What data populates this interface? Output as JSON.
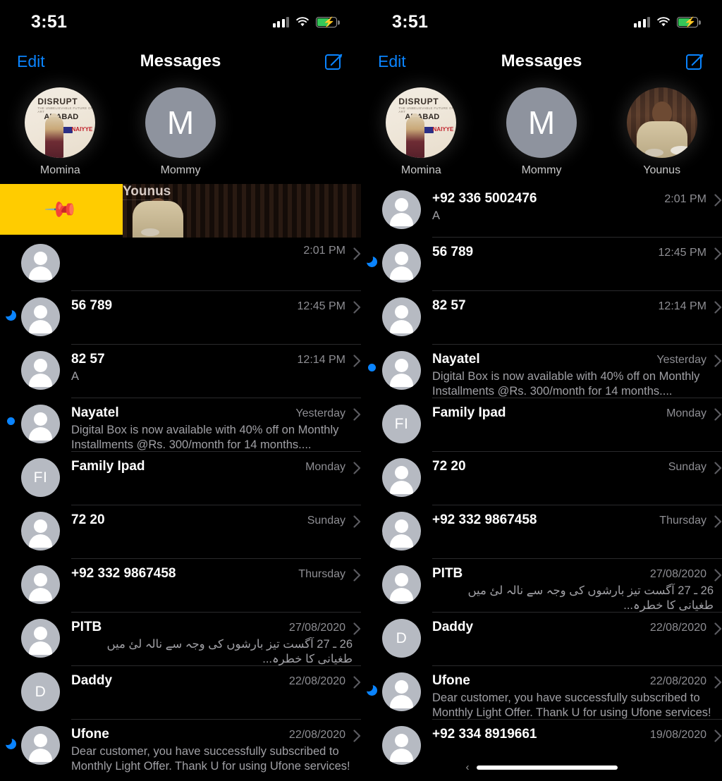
{
  "status_bar": {
    "time": "3:51",
    "battery_state": "charging",
    "signal_bars": 3,
    "wifi": "wifi-icon"
  },
  "nav": {
    "edit_label": "Edit",
    "title": "Messages",
    "compose_icon": "compose-icon"
  },
  "left_screen": {
    "pinned": [
      {
        "name": "Momina",
        "avatar_type": "photo",
        "photo_text": [
          "DISRUPT",
          "AMABAD",
          "NAIYYE"
        ]
      },
      {
        "name": "Mommy",
        "avatar_type": "monogram",
        "initial": "M"
      }
    ],
    "swiped_row": {
      "action_label": "Pin",
      "action_icon": "pin-icon",
      "action_color": "#ffcc00",
      "name": "Younus",
      "avatar_type": "photo"
    },
    "conversations": [
      {
        "name": "",
        "time": "2:01 PM",
        "preview": "",
        "badge": "",
        "avatar": "person",
        "name_hidden": true
      },
      {
        "name": "56 789",
        "time": "12:45 PM",
        "preview": "",
        "badge": "moon",
        "avatar": "person"
      },
      {
        "name": "82 57",
        "time": "12:14 PM",
        "preview": "A",
        "badge": "",
        "avatar": "person"
      },
      {
        "name": "Nayatel",
        "time": "Yesterday",
        "preview": "Digital Box is now available with 40% off on Monthly Installments @Rs. 300/month for 14 months....",
        "badge": "dot",
        "avatar": "person"
      },
      {
        "name": "Family Ipad",
        "time": "Monday",
        "preview": "",
        "badge": "",
        "avatar": "initials",
        "initials": "FI"
      },
      {
        "name": "72 20",
        "time": "Sunday",
        "preview": "",
        "badge": "",
        "avatar": "person"
      },
      {
        "name": "+92 332 9867458",
        "time": "Thursday",
        "preview": "",
        "badge": "",
        "avatar": "person"
      },
      {
        "name": "PITB",
        "time": "27/08/2020",
        "preview": "26 ـ 27 آگست تیز بارشوں کی وجہ سے نالہ لئ میں طغیانی کا خطرہ...",
        "badge": "",
        "avatar": "person",
        "rtl": true
      },
      {
        "name": "Daddy",
        "time": "22/08/2020",
        "preview": "",
        "badge": "",
        "avatar": "initials",
        "initials": "D"
      },
      {
        "name": "Ufone",
        "time": "22/08/2020",
        "preview": "Dear customer, you have successfully subscribed to Monthly Light Offer. Thank U for using Ufone services!",
        "badge": "moon",
        "avatar": "person"
      }
    ]
  },
  "right_screen": {
    "pinned": [
      {
        "name": "Momina",
        "avatar_type": "photo",
        "photo_text": [
          "DISRUPT",
          "AMABAD",
          "NAIYYE"
        ]
      },
      {
        "name": "Mommy",
        "avatar_type": "monogram",
        "initial": "M"
      },
      {
        "name": "Younus",
        "avatar_type": "photo"
      }
    ],
    "conversations": [
      {
        "name": "+92 336 5002476",
        "time": "2:01 PM",
        "preview": "A",
        "badge": "",
        "avatar": "person"
      },
      {
        "name": "56 789",
        "time": "12:45 PM",
        "preview": "",
        "badge": "moon",
        "avatar": "person"
      },
      {
        "name": "82 57",
        "time": "12:14 PM",
        "preview": "",
        "badge": "",
        "avatar": "person"
      },
      {
        "name": "Nayatel",
        "time": "Yesterday",
        "preview": "Digital Box is now available with 40% off on Monthly Installments @Rs. 300/month for 14 months....",
        "badge": "dot",
        "avatar": "person"
      },
      {
        "name": "Family Ipad",
        "time": "Monday",
        "preview": "",
        "badge": "",
        "avatar": "initials",
        "initials": "FI"
      },
      {
        "name": "72 20",
        "time": "Sunday",
        "preview": "",
        "badge": "",
        "avatar": "person"
      },
      {
        "name": "+92 332 9867458",
        "time": "Thursday",
        "preview": "",
        "badge": "",
        "avatar": "person"
      },
      {
        "name": "PITB",
        "time": "27/08/2020",
        "preview": "26 ـ 27 آگست تیز بارشوں کی وجہ سے نالہ لئ میں طغیانی کا خطرہ...",
        "badge": "",
        "avatar": "person",
        "rtl": true
      },
      {
        "name": "Daddy",
        "time": "22/08/2020",
        "preview": "",
        "badge": "",
        "avatar": "initials",
        "initials": "D"
      },
      {
        "name": "Ufone",
        "time": "22/08/2020",
        "preview": "Dear customer, you have successfully subscribed to Monthly Light Offer. Thank U for using Ufone services!",
        "badge": "moon",
        "avatar": "person"
      },
      {
        "name": "+92 334 8919661",
        "time": "19/08/2020",
        "preview": "",
        "badge": "",
        "avatar": "person"
      }
    ],
    "home_indicator": {
      "back_icon": "chevron-left-icon"
    }
  },
  "colors": {
    "accent": "#0a84ff",
    "pin_yellow": "#ffcc00",
    "battery_green": "#35c759",
    "background": "#000000"
  }
}
